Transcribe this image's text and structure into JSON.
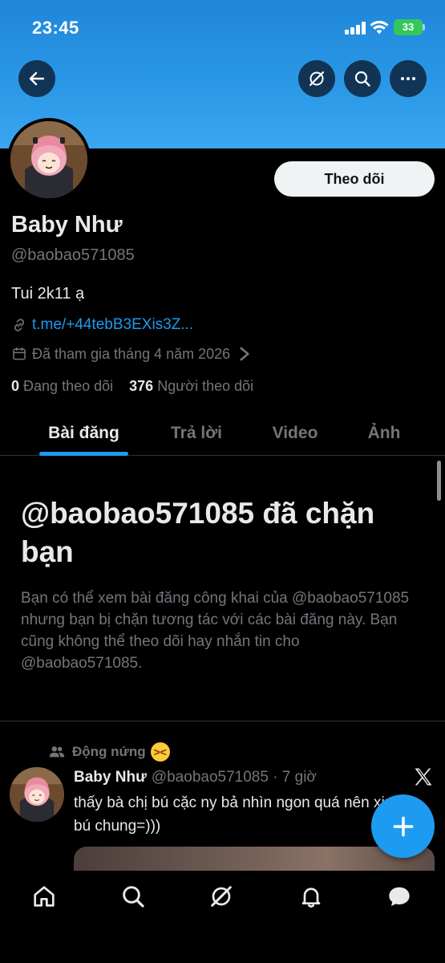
{
  "status_bar": {
    "time": "23:45",
    "battery": "33"
  },
  "header": {
    "back_icon": "arrow-left-icon",
    "grok_icon": "grok-icon",
    "search_icon": "search-icon",
    "more_icon": "more-horizontal-icon"
  },
  "profile": {
    "follow_label": "Theo dõi",
    "name": "Baby Như",
    "handle": "@baobao571085",
    "bio": "Tui 2k11 ạ",
    "link": "t.me/+44tebB3EXis3Z...",
    "joined": "Đã tham gia tháng 4 năm 2026",
    "following_count": "0",
    "following_label": "Đang theo dõi",
    "followers_count": "376",
    "followers_label": "Người theo dõi"
  },
  "tabs": [
    {
      "label": "Bài đăng",
      "active": true
    },
    {
      "label": "Trả lời",
      "active": false
    },
    {
      "label": "Video",
      "active": false
    },
    {
      "label": "Ảnh",
      "active": false
    }
  ],
  "blocked": {
    "title": "@baobao571085 đã chặn bạn",
    "body": "Bạn có thể xem bài đăng công khai của @baobao571085 nhưng bạn bị chặn tương tác với các bài đăng này. Bạn cũng không thể theo dõi hay nhắn tin cho @baobao571085."
  },
  "post": {
    "context": "Động nứng",
    "context_emoji": "squinting-tongue-emoji",
    "author": "Baby Như",
    "meta": "@baobao571085 · 7 giờ",
    "text": "thấy bà chị bú cặc ny bả nhìn ngon quá nên xin bú chung=)))"
  },
  "colors": {
    "accent": "#1d9bf0",
    "muted": "#71767b",
    "text": "#e7e9ea",
    "background": "#000000",
    "banner": "#2a97e6"
  }
}
